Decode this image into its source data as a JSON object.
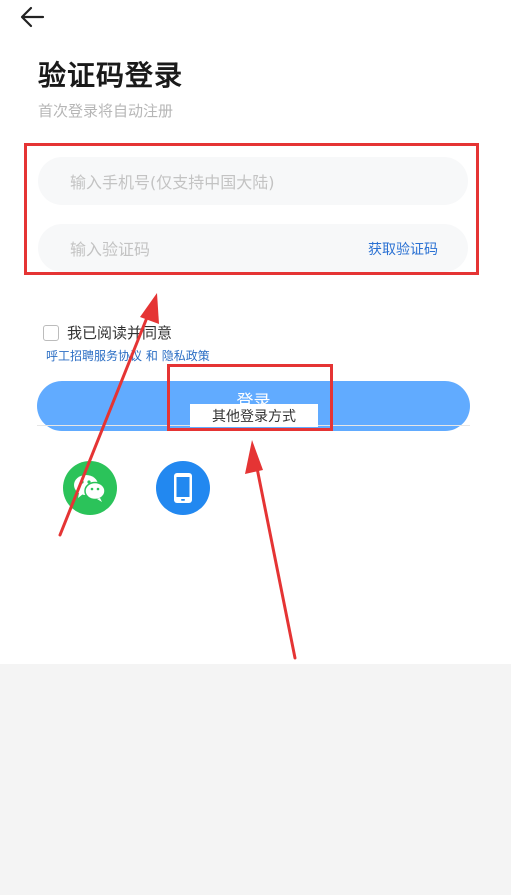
{
  "header": {
    "back_icon": "arrow-left-icon"
  },
  "title": "验证码登录",
  "subtitle": "首次登录将自动注册",
  "phone_input": {
    "placeholder": "输入手机号(仅支持中国大陆)"
  },
  "code_input": {
    "placeholder": "输入验证码"
  },
  "get_code_label": "获取验证码",
  "agreement": {
    "label": "我已阅读并同意",
    "link_service": "呼工招聘服务协议",
    "conjunction": "和",
    "link_privacy": "隐私政策"
  },
  "login_button_label": "登录",
  "other_login_label": "其他登录方式",
  "social": {
    "wechat_icon": "wechat-icon",
    "phone_icon": "mobile-phone-icon"
  },
  "colors": {
    "accent": "#61abff",
    "link": "#2a71d3",
    "annotation": "#e53434",
    "wechat": "#2bc35a",
    "phone": "#2288f0"
  }
}
